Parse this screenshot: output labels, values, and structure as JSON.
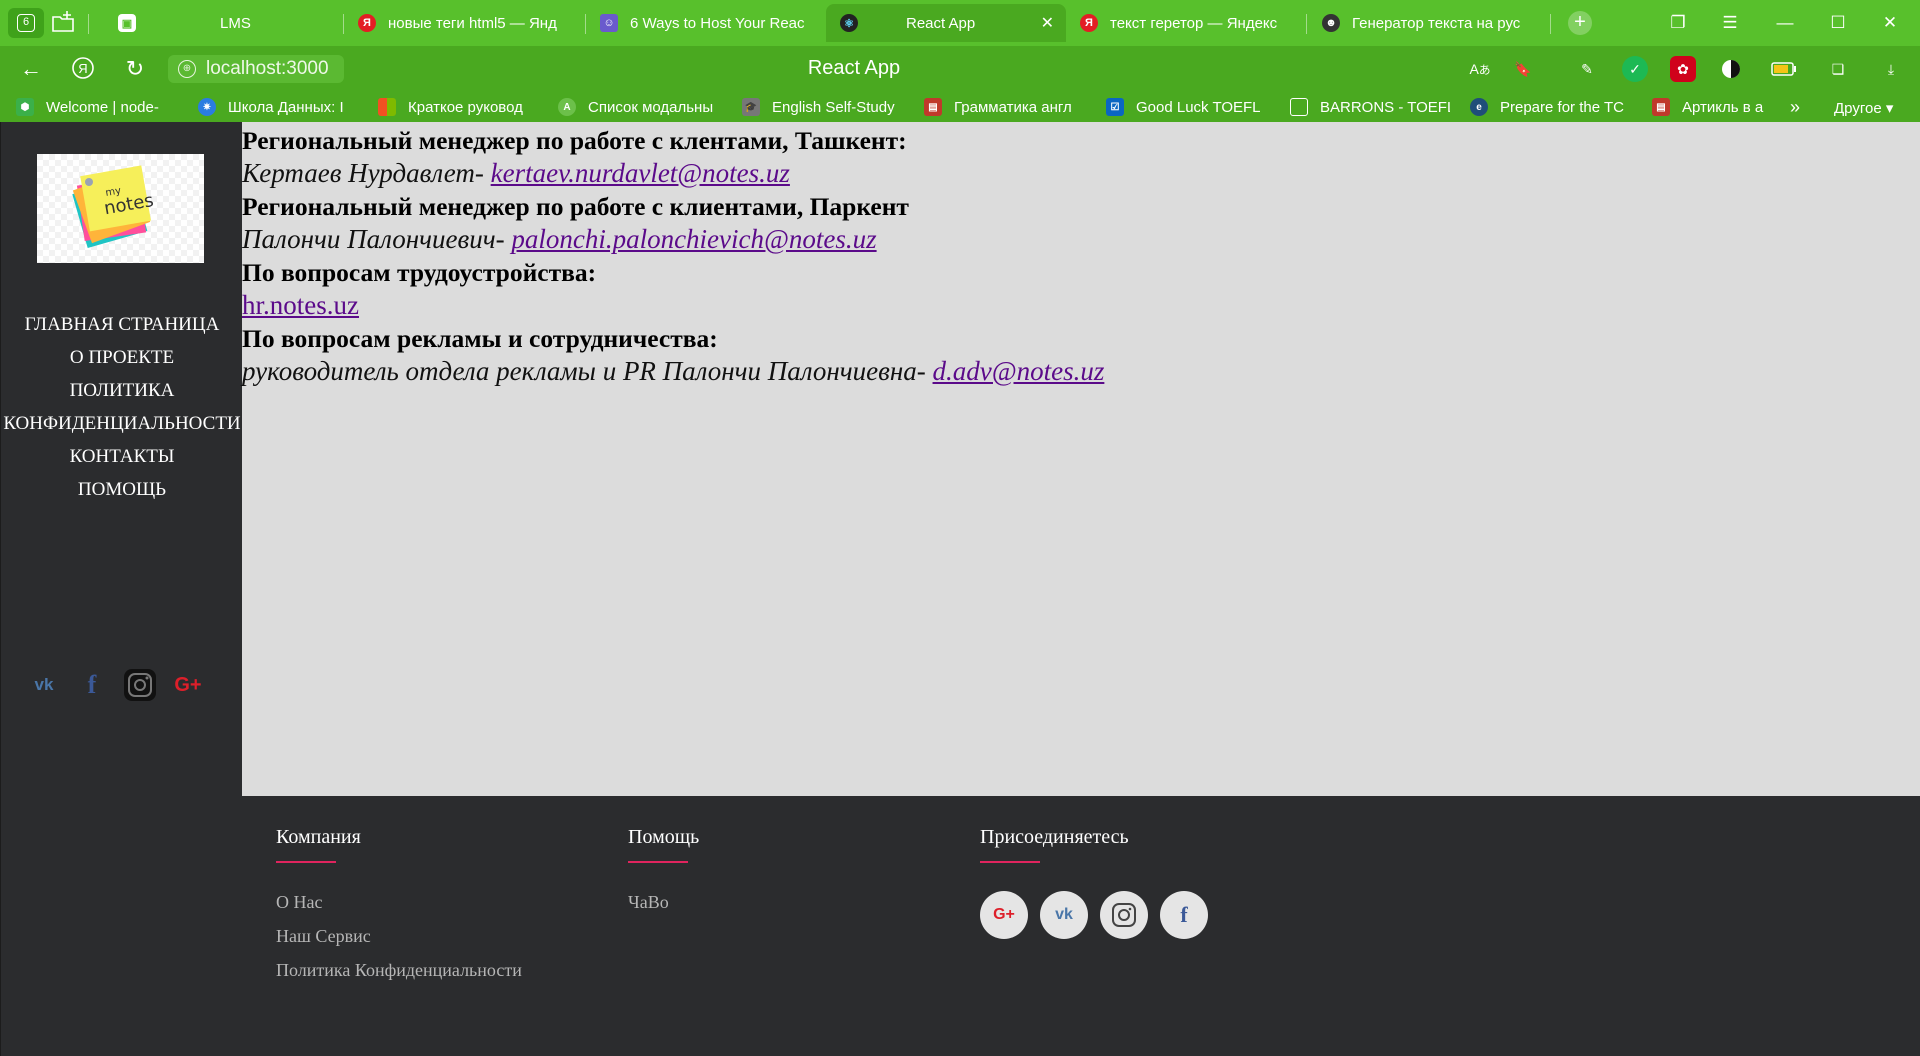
{
  "browser": {
    "tab_count": "6",
    "tabs": [
      {
        "title": "LMS",
        "icon": "lms-icon"
      },
      {
        "title": "новые теги html5 — Янд",
        "icon": "yandex-icon"
      },
      {
        "title": "6 Ways to Host Your Reac",
        "icon": "article-icon"
      },
      {
        "title": "React App",
        "icon": "react-icon"
      },
      {
        "title": "текст геретор — Яндекс",
        "icon": "yandex-icon"
      },
      {
        "title": "Генератор текста на рус",
        "icon": "generator-icon"
      }
    ],
    "url": "localhost:3000",
    "page_title": "React App",
    "bookmarks": [
      {
        "label": "Welcome | node-",
        "icon": "node-icon"
      },
      {
        "label": "Школа Данных: I",
        "icon": "school-icon"
      },
      {
        "label": "Краткое руковод",
        "icon": "microsoft-icon"
      },
      {
        "label": "Список модальны",
        "icon": "list-icon"
      },
      {
        "label": "English Self-Study",
        "icon": "graduation-icon"
      },
      {
        "label": "Грамматика англ",
        "icon": "book-icon"
      },
      {
        "label": "Good Luck TOEFL",
        "icon": "check-icon"
      },
      {
        "label": "BARRONS - TOEFL",
        "icon": "doc-icon"
      },
      {
        "label": "Prepare for the TC",
        "icon": "ets-icon"
      },
      {
        "label": "Артикль в а",
        "icon": "book-icon"
      }
    ],
    "bookmarks_other": "Другое ▾"
  },
  "sidebar": {
    "menu": [
      "ГЛАВНАЯ СТРАНИЦА",
      "О ПРОЕКТЕ",
      "ПОЛИТИКА",
      "КОНФИДЕНЦИАЛЬНОСТИ",
      "КОНТАКТЫ",
      "ПОМОЩЬ"
    ],
    "social": [
      "vk-icon",
      "facebook-icon",
      "instagram-icon",
      "google-plus-icon"
    ]
  },
  "contacts": {
    "h1": "Региональный менеджер по работе с клентами, Ташкент:",
    "p1_text": "Кертаев Нурдавлет- ",
    "p1_email": "kertaev.nurdavlet@notes.uz",
    "h2": "Региональный менеджер по работе с клиентами, Паркент",
    "p2_text": "Палончи Палончиевич- ",
    "p2_email": "palonchi.palonchievich@notes.uz",
    "h3": "По вопросам трудоустройства:",
    "p3_link": "hr.notes.uz",
    "h4": "По вопросам рекламы и сотрудничества:",
    "p4_text": "руководитель отдела рекламы и PR Палончи Палончиевна- ",
    "p4_email": "d.adv@notes.uz"
  },
  "footer": {
    "company": {
      "title": "Компания",
      "links": [
        "О Нас",
        "Наш Сервис",
        "Политика Конфиденциальности"
      ]
    },
    "help": {
      "title": "Помощь",
      "links": [
        "ЧаВо"
      ]
    },
    "join": {
      "title": "Присоединяетесь",
      "social": [
        "google-plus-icon",
        "vk-icon",
        "instagram-icon",
        "facebook-icon"
      ]
    }
  },
  "colors": {
    "browser_green": "#58c02c",
    "sidebar_bg": "#2b2c2e",
    "content_bg": "#dcdcdc",
    "link_purple": "#5b0a8a",
    "footer_accent": "#e0245e"
  }
}
